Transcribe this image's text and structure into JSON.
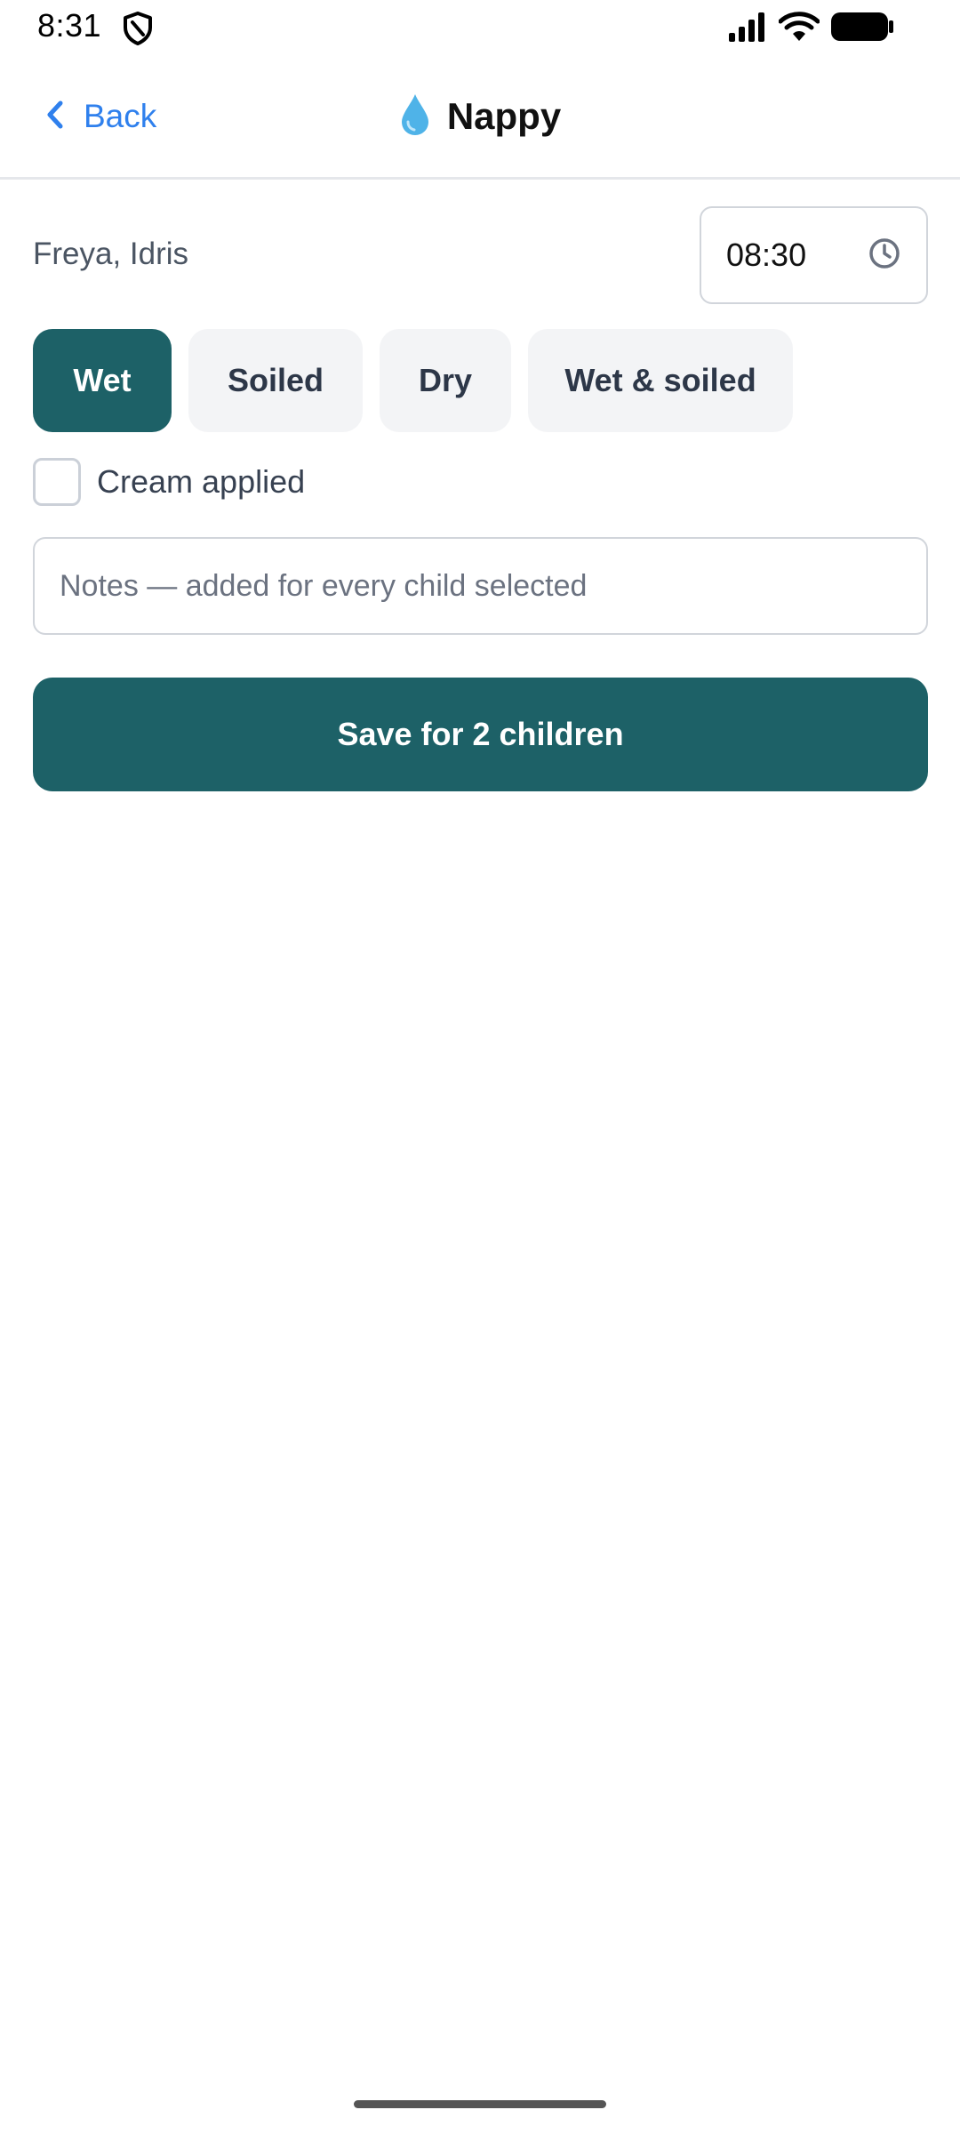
{
  "status_bar": {
    "time": "8:31",
    "icons": [
      "shield-icon",
      "signal-icon",
      "wifi-icon",
      "battery-icon"
    ]
  },
  "nav": {
    "back_label": "Back",
    "title": "Nappy",
    "title_icon": "droplet-icon"
  },
  "form": {
    "children_names": "Freya, Idris",
    "time_value": "08:30",
    "nappy_types": [
      {
        "label": "Wet",
        "selected": true
      },
      {
        "label": "Soiled",
        "selected": false
      },
      {
        "label": "Dry",
        "selected": false
      },
      {
        "label": "Wet & soiled",
        "selected": false
      }
    ],
    "cream_label": "Cream applied",
    "cream_checked": false,
    "notes_placeholder": "Notes — added for every child selected",
    "notes_value": "",
    "save_label": "Save for 2 children"
  },
  "colors": {
    "accent": "#1d6167",
    "link": "#2f80ed",
    "chip_bg": "#f3f4f6",
    "droplet": "#4fb3e8"
  }
}
